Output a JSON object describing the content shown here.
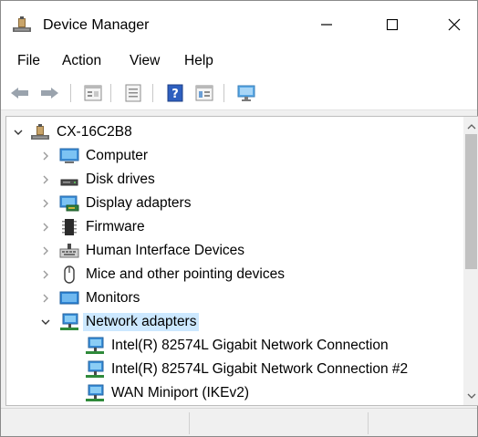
{
  "window": {
    "title": "Device Manager",
    "controls": {
      "minimize": "minimize",
      "maximize": "maximize",
      "close": "close"
    }
  },
  "menu": {
    "items": [
      "File",
      "Action",
      "View",
      "Help"
    ]
  },
  "toolbar": {
    "buttons": [
      "back-icon",
      "forward-icon",
      "properties-view-icon",
      "list-view-icon",
      "help-icon",
      "resource-view-icon",
      "monitor-icon"
    ]
  },
  "tree": {
    "root": "CX-16C2B8",
    "categories": [
      {
        "label": "Computer",
        "icon": "computer-icon",
        "expanded": false
      },
      {
        "label": "Disk drives",
        "icon": "disk-drive-icon",
        "expanded": false
      },
      {
        "label": "Display adapters",
        "icon": "display-adapter-icon",
        "expanded": false
      },
      {
        "label": "Firmware",
        "icon": "firmware-chip-icon",
        "expanded": false
      },
      {
        "label": "Human Interface Devices",
        "icon": "hid-icon",
        "expanded": false
      },
      {
        "label": "Mice and other pointing devices",
        "icon": "mouse-icon",
        "expanded": false
      },
      {
        "label": "Monitors",
        "icon": "monitor-icon",
        "expanded": false
      },
      {
        "label": "Network adapters",
        "icon": "network-adapter-icon",
        "expanded": true,
        "selected": true
      }
    ],
    "children": [
      {
        "label": "Intel(R) 82574L Gigabit Network Connection",
        "icon": "network-adapter-icon"
      },
      {
        "label": "Intel(R) 82574L Gigabit Network Connection #2",
        "icon": "network-adapter-icon"
      },
      {
        "label": "WAN Miniport (IKEv2)",
        "icon": "network-adapter-icon"
      }
    ]
  },
  "colors": {
    "selection": "#cce8ff",
    "title_bg": "#ffffff",
    "chrome": "#f0f0f0"
  }
}
